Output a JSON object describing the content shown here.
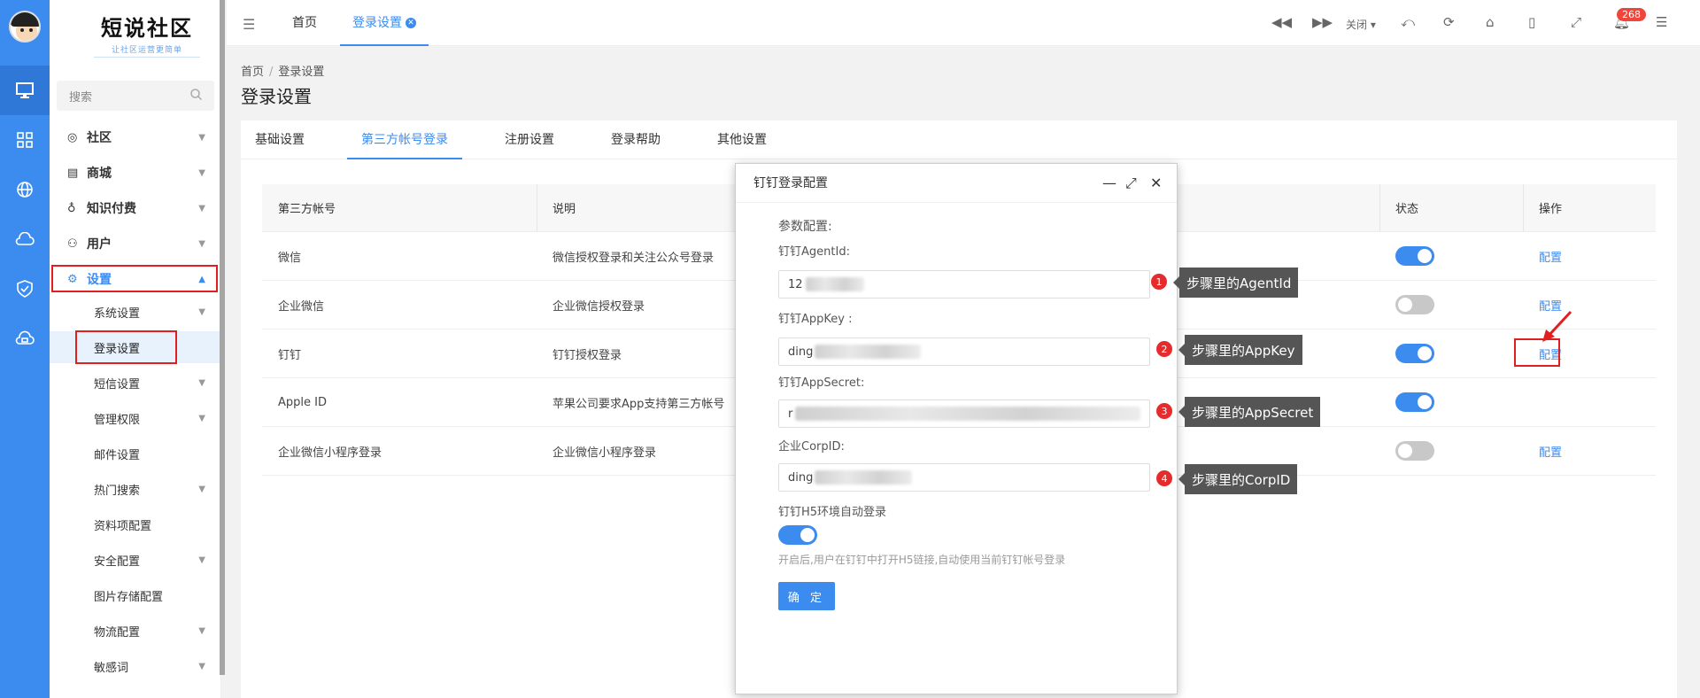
{
  "sidebar": {
    "logo_title": "短说社区",
    "logo_subtitle": "让社区运营更简单",
    "search_placeholder": "搜索",
    "menu": [
      {
        "label": "社区",
        "icon": "community-icon"
      },
      {
        "label": "商城",
        "icon": "store-icon"
      },
      {
        "label": "知识付费",
        "icon": "bulb-icon"
      },
      {
        "label": "用户",
        "icon": "users-icon"
      },
      {
        "label": "设置",
        "icon": "gear-icon"
      }
    ],
    "submenu": [
      {
        "label": "系统设置"
      },
      {
        "label": "登录设置"
      },
      {
        "label": "短信设置"
      },
      {
        "label": "管理权限"
      },
      {
        "label": "邮件设置"
      },
      {
        "label": "热门搜索"
      },
      {
        "label": "资料项配置"
      },
      {
        "label": "安全配置"
      },
      {
        "label": "图片存储配置"
      },
      {
        "label": "物流配置"
      },
      {
        "label": "敏感词"
      }
    ]
  },
  "topbar": {
    "tabs": [
      {
        "label": "首页"
      },
      {
        "label": "登录设置"
      }
    ],
    "close_label": "关闭",
    "notification_count": "268"
  },
  "breadcrumb": {
    "home": "首页",
    "current": "登录设置"
  },
  "page_title": "登录设置",
  "content_tabs": [
    {
      "label": "基础设置"
    },
    {
      "label": "第三方帐号登录"
    },
    {
      "label": "注册设置"
    },
    {
      "label": "登录帮助"
    },
    {
      "label": "其他设置"
    }
  ],
  "table": {
    "headers": {
      "account": "第三方帐号",
      "desc": "说明",
      "status": "状态",
      "action": "操作"
    },
    "rows": [
      {
        "account": "微信",
        "desc": "微信授权登录和关注公众号登录",
        "status": "on",
        "action": "配置"
      },
      {
        "account": "企业微信",
        "desc": "企业微信授权登录",
        "status": "off",
        "action": "配置"
      },
      {
        "account": "钉钉",
        "desc": "钉钉授权登录",
        "status": "on",
        "action": "配置"
      },
      {
        "account": "Apple ID",
        "desc": "苹果公司要求App支持第三方帐号",
        "status": "on",
        "action": ""
      },
      {
        "account": "企业微信小程序登录",
        "desc": "企业微信小程序登录",
        "status": "off",
        "action": "配置"
      }
    ]
  },
  "dialog": {
    "title": "钉钉登录配置",
    "section_label": "参数配置:",
    "fields": [
      {
        "label": "钉钉AgentId:",
        "value": "12"
      },
      {
        "label": "钉钉AppKey :",
        "value": "ding"
      },
      {
        "label": "钉钉AppSecret:",
        "value": "r"
      },
      {
        "label": "企业CorpID:",
        "value": "ding"
      }
    ],
    "h5_label": "钉钉H5环境自动登录",
    "h5_enabled": true,
    "hint": "开启后,用户在钉钉中打开H5链接,自动使用当前钉钉帐号登录",
    "confirm": "确 定"
  },
  "annotations": [
    {
      "num": "1",
      "text": "步骤里的AgentId"
    },
    {
      "num": "2",
      "text": "步骤里的AppKey"
    },
    {
      "num": "3",
      "text": "步骤里的AppSecret"
    },
    {
      "num": "4",
      "text": "步骤里的CorpID"
    }
  ],
  "colors": {
    "accent": "#3c8cf0",
    "annotation_red": "#e02020"
  }
}
